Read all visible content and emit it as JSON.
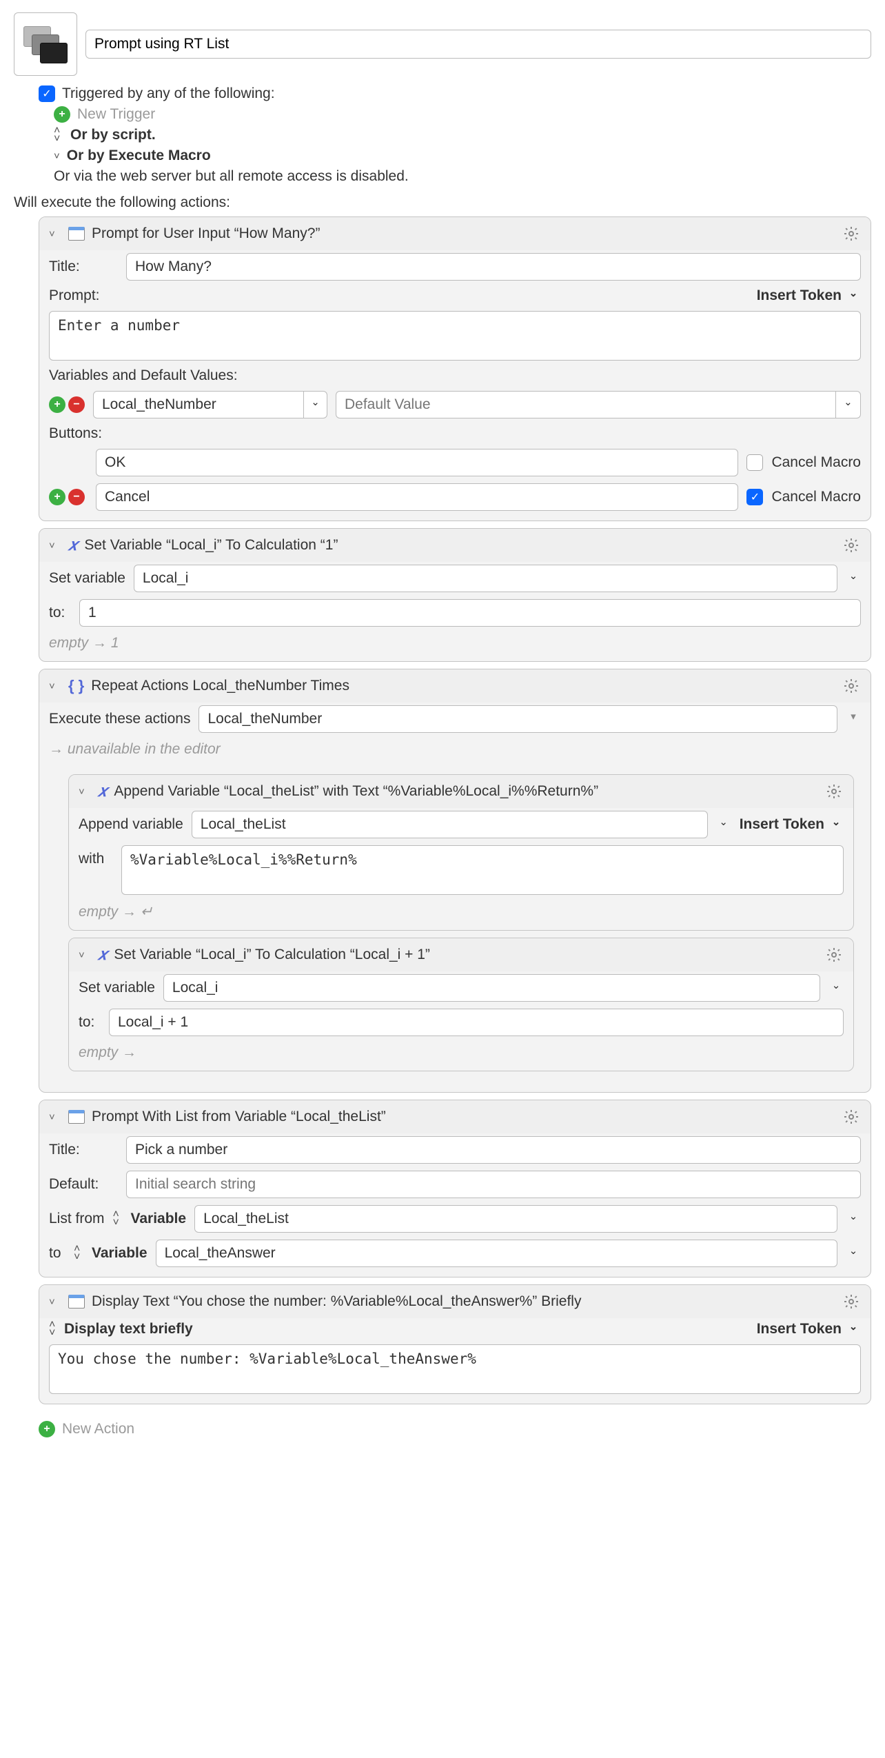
{
  "macro_name": "Prompt using RT List",
  "triggered_label": "Triggered by any of the following:",
  "new_trigger_label": "New Trigger",
  "or_by_script_label": "Or by script.",
  "or_by_execute_label": "Or by Execute Macro",
  "remote_label": "Or via the web server but all remote access is disabled.",
  "will_execute_label": "Will execute the following actions:",
  "insert_token_label": "Insert Token",
  "cancel_macro_label": "Cancel Macro",
  "actions": {
    "a1": {
      "header": "Prompt for User Input “How Many?”",
      "title_label": "Title:",
      "title_value": "How Many?",
      "prompt_label": "Prompt:",
      "prompt_value": "Enter a number",
      "vars_label": "Variables and Default Values:",
      "var_name": "Local_theNumber",
      "var_default_placeholder": "Default Value",
      "buttons_label": "Buttons:",
      "btn_ok": "OK",
      "btn_cancel": "Cancel"
    },
    "a2": {
      "header": "Set Variable “Local_i” To Calculation “1”",
      "set_label": "Set variable",
      "var_name": "Local_i",
      "to_label": "to:",
      "to_value": "1",
      "ghost_prefix": "empty",
      "ghost_value": "1"
    },
    "a3": {
      "header": "Repeat Actions Local_theNumber Times",
      "exec_label": "Execute these actions",
      "count_var": "Local_theNumber",
      "unavailable": "unavailable in the editor",
      "sub1": {
        "header": "Append Variable “Local_theList” with Text “%Variable%Local_i%%Return%”",
        "append_label": "Append variable",
        "var_name": "Local_theList",
        "with_label": "with",
        "with_value": "%Variable%Local_i%%Return%",
        "ghost_prefix": "empty",
        "ghost_value": "↵"
      },
      "sub2": {
        "header": "Set Variable “Local_i” To Calculation “Local_i + 1”",
        "set_label": "Set variable",
        "var_name": "Local_i",
        "to_label": "to:",
        "to_value": "Local_i + 1",
        "ghost_prefix": "empty"
      }
    },
    "a4": {
      "header": "Prompt With List from Variable “Local_theList”",
      "title_label": "Title:",
      "title_value": "Pick a number",
      "default_label": "Default:",
      "default_placeholder": "Initial search string",
      "list_from_label": "List from",
      "variable_label": "Variable",
      "list_var": "Local_theList",
      "to_label": "to",
      "dest_var": "Local_theAnswer"
    },
    "a5": {
      "header": "Display Text “You chose the number: %Variable%Local_theAnswer%” Briefly",
      "display_label": "Display text briefly",
      "text_value": "You chose the number: %Variable%Local_theAnswer%"
    }
  },
  "new_action_label": "New Action"
}
